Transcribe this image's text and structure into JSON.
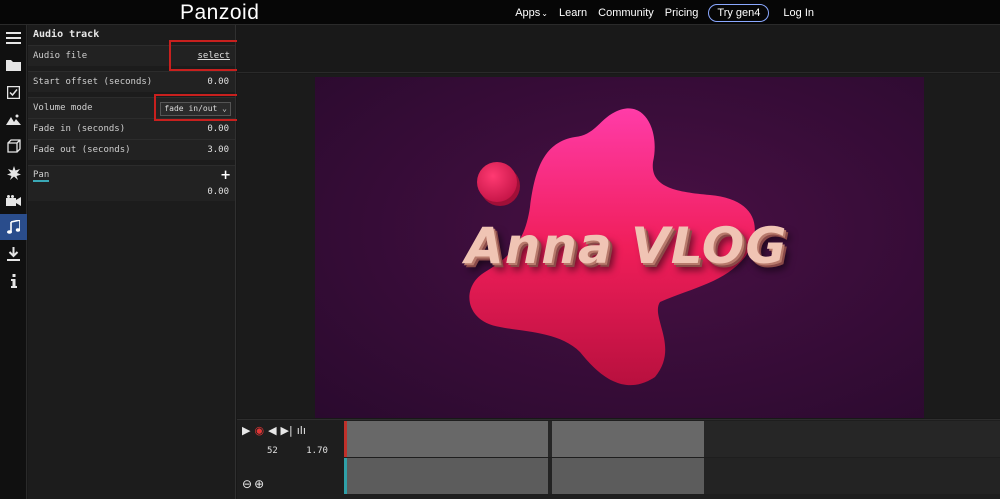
{
  "topbar": {
    "logo": "Panzoid",
    "nav": {
      "apps": "Apps",
      "learn": "Learn",
      "community": "Community",
      "pricing": "Pricing",
      "try": "Try gen4",
      "login": "Log In"
    }
  },
  "rail": {
    "icons": [
      "menu-icon",
      "folder-icon",
      "checkbox-icon",
      "image-icon",
      "cube-icon",
      "effects-icon",
      "camera-icon",
      "music-icon",
      "download-icon",
      "info-icon"
    ],
    "active": "music-icon"
  },
  "panel": {
    "title": "Audio track",
    "audio_file": {
      "label": "Audio file",
      "action": "select"
    },
    "start_offset": {
      "label": "Start offset (seconds)",
      "value": "0.00"
    },
    "volume_mode": {
      "label": "Volume mode",
      "value": "fade in/out"
    },
    "fade_in": {
      "label": "Fade in (seconds)",
      "value": "0.00"
    },
    "fade_out": {
      "label": "Fade out (seconds)",
      "value": "3.00"
    },
    "pan": {
      "label": "Pan",
      "value": "0.00"
    }
  },
  "canvas": {
    "text": "Anna VLOG"
  },
  "timeline": {
    "frame": "52",
    "time": "1.70"
  },
  "colors": {
    "highlight": "#c8201e",
    "accent": "#2a4d8c",
    "blob": "#e0245c"
  }
}
